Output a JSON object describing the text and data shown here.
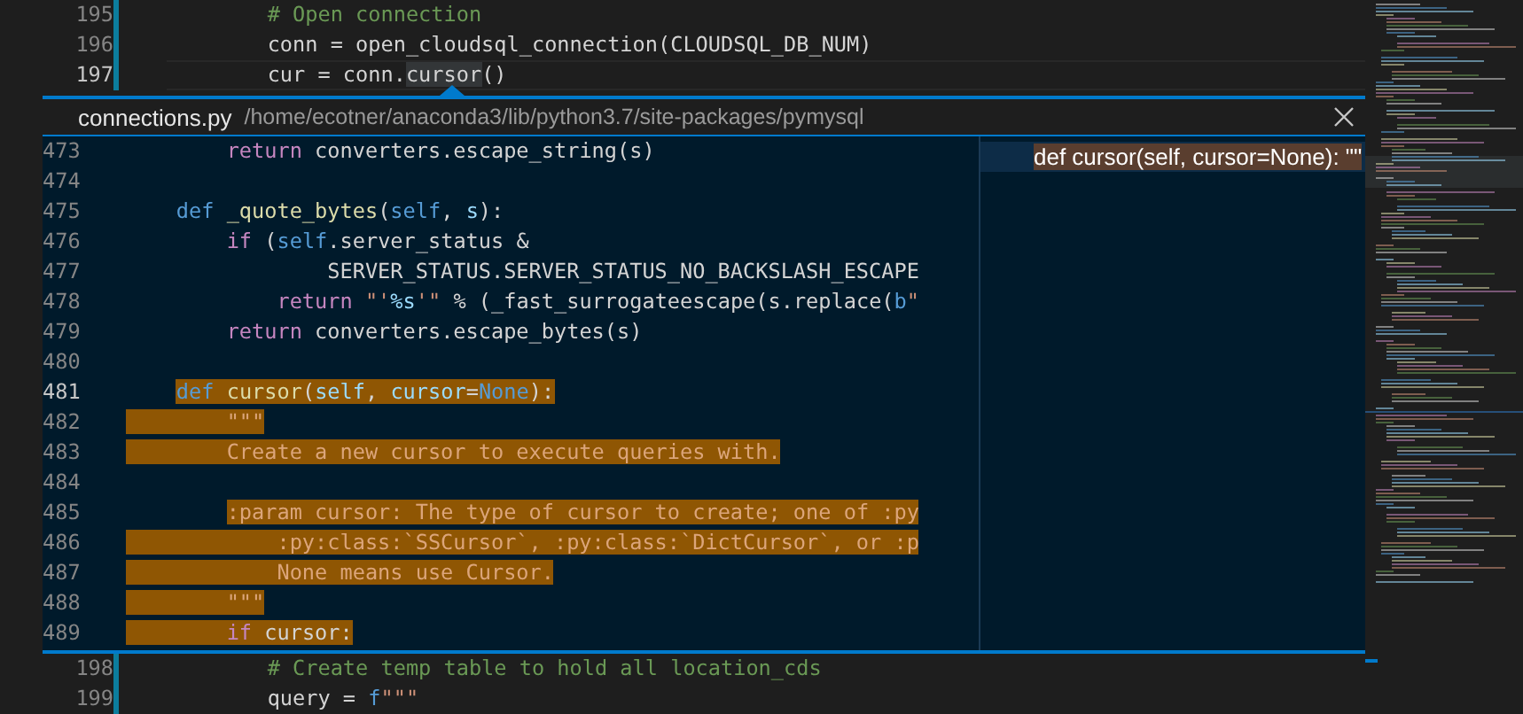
{
  "editor_top": {
    "lines": [
      {
        "number": "195",
        "current": false,
        "tokens": [
          {
            "t": "        # Open connection",
            "kind": "comment"
          }
        ]
      },
      {
        "number": "196",
        "current": false,
        "tokens": [
          {
            "t": "        conn = open_cloudsql_connection(CLOUDSQL_DB_NUM)",
            "kind": "plain"
          }
        ]
      },
      {
        "number": "197",
        "current": true,
        "tokens": [
          {
            "t": "        cur = conn.",
            "kind": "plain"
          },
          {
            "t": "cursor",
            "kind": "reference"
          },
          {
            "t": "()",
            "kind": "plain"
          }
        ]
      }
    ]
  },
  "peek": {
    "file": "connections.py",
    "path": "/home/ecotner/anaconda3/lib/python3.7/site-packages/pymysql",
    "lines": [
      {
        "number": "473",
        "current": false,
        "selected": false,
        "tokens": [
          {
            "t": "        return",
            "kind": "control"
          },
          {
            "t": " converters.escape_string(s)",
            "kind": "plain"
          }
        ]
      },
      {
        "number": "474",
        "current": false,
        "selected": false
      },
      {
        "number": "475",
        "current": false,
        "selected": false,
        "tokens": [
          {
            "t": "    def",
            "kind": "keyword"
          },
          {
            "t": " _quote_bytes",
            "kind": "function"
          },
          {
            "t": "(",
            "kind": "plain"
          },
          {
            "t": "self",
            "kind": "keyword"
          },
          {
            "t": ", ",
            "kind": "plain"
          },
          {
            "t": "s",
            "kind": "variable"
          },
          {
            "t": "):",
            "kind": "plain"
          }
        ]
      },
      {
        "number": "476",
        "current": false,
        "selected": false,
        "tokens": [
          {
            "t": "        if",
            "kind": "control"
          },
          {
            "t": " (",
            "kind": "plain"
          },
          {
            "t": "self",
            "kind": "keyword"
          },
          {
            "t": ".server_status &",
            "kind": "plain"
          }
        ]
      },
      {
        "number": "477",
        "current": false,
        "selected": false,
        "tokens": [
          {
            "t": "                SERVER_STATUS.SERVER_STATUS_NO_BACKSLASH_ESCAPE",
            "kind": "plain"
          }
        ]
      },
      {
        "number": "478",
        "current": false,
        "selected": false,
        "tokens": [
          {
            "t": "            return",
            "kind": "control"
          },
          {
            "t": " \"'",
            "kind": "string"
          },
          {
            "t": "%s",
            "kind": "variable"
          },
          {
            "t": "'\"",
            "kind": "string"
          },
          {
            "t": " % (_fast_surrogateescape(s.replace(",
            "kind": "plain"
          },
          {
            "t": "b",
            "kind": "keyword"
          },
          {
            "t": "\"",
            "kind": "string"
          }
        ]
      },
      {
        "number": "479",
        "current": false,
        "selected": false,
        "tokens": [
          {
            "t": "        return",
            "kind": "control"
          },
          {
            "t": " converters.escape_bytes(s)",
            "kind": "plain"
          }
        ]
      },
      {
        "number": "480",
        "current": false,
        "selected": false
      },
      {
        "number": "481",
        "current": true,
        "selected": true,
        "tokens": [
          {
            "t": "    def",
            "kind": "keyword"
          },
          {
            "t": " cursor",
            "kind": "function"
          },
          {
            "t": "(",
            "kind": "plain"
          },
          {
            "t": "self",
            "kind": "variable"
          },
          {
            "t": ", ",
            "kind": "plain"
          },
          {
            "t": "cursor",
            "kind": "variable"
          },
          {
            "t": "=",
            "kind": "plain"
          },
          {
            "t": "None",
            "kind": "keyword"
          },
          {
            "t": "):",
            "kind": "plain"
          }
        ]
      },
      {
        "number": "482",
        "current": false,
        "selected": true,
        "tokens": [
          {
            "t": "        \"\"\"",
            "kind": "docstring"
          }
        ]
      },
      {
        "number": "483",
        "current": false,
        "selected": true,
        "tokens": [
          {
            "t": "        Create a new cursor to execute queries with.",
            "kind": "docstring"
          }
        ]
      },
      {
        "number": "484",
        "current": false,
        "selected": false
      },
      {
        "number": "485",
        "current": false,
        "selected": true,
        "tokens": [
          {
            "t": "        :param cursor: The type of cursor to create; one of :py",
            "kind": "docstring"
          }
        ]
      },
      {
        "number": "486",
        "current": false,
        "selected": true,
        "tokens": [
          {
            "t": "            :py:class:`SSCursor`, :py:class:`DictCursor`, or :p",
            "kind": "docstring"
          }
        ]
      },
      {
        "number": "487",
        "current": false,
        "selected": true,
        "tokens": [
          {
            "t": "            None means use Cursor.",
            "kind": "docstring"
          }
        ]
      },
      {
        "number": "488",
        "current": false,
        "selected": true,
        "tokens": [
          {
            "t": "        \"\"\"",
            "kind": "docstring"
          }
        ]
      },
      {
        "number": "489",
        "current": false,
        "selected": true,
        "tokens": [
          {
            "t": "        if",
            "kind": "control"
          },
          {
            "t": " cursor:",
            "kind": "plain"
          }
        ]
      }
    ],
    "references": [
      {
        "label": "def cursor(self, cursor=None): \"\"",
        "selected": true
      }
    ]
  },
  "editor_bottom": {
    "lines": [
      {
        "number": "198",
        "current": false,
        "tokens": [
          {
            "t": "        # Create temp table to hold all location_cds",
            "kind": "comment"
          }
        ]
      },
      {
        "number": "199",
        "current": false,
        "tokens": [
          {
            "t": "        query = ",
            "kind": "plain"
          },
          {
            "t": "f",
            "kind": "keyword"
          },
          {
            "t": "\"\"\"",
            "kind": "string"
          }
        ]
      }
    ]
  }
}
